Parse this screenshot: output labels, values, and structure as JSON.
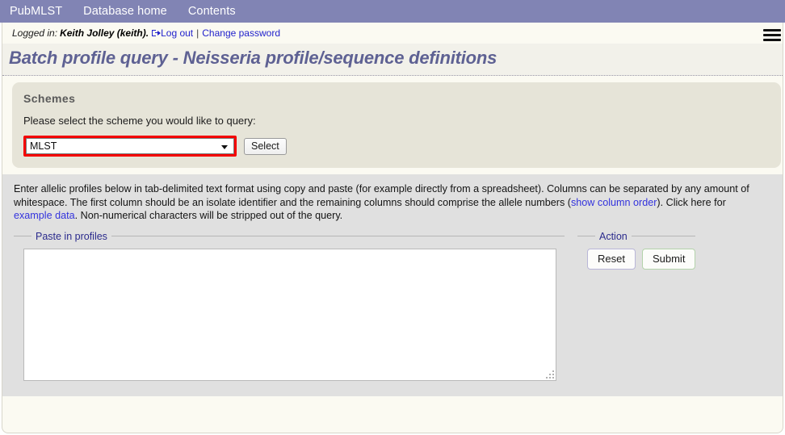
{
  "nav": {
    "items": [
      {
        "label": "PubMLST"
      },
      {
        "label": "Database home"
      },
      {
        "label": "Contents"
      }
    ]
  },
  "login_bar": {
    "logged_in_label": "Logged in:",
    "user": "Keith Jolley (keith).",
    "logout_label": "Log out",
    "separator": "|",
    "change_password_label": "Change password",
    "menu_icon": "hamburger-icon"
  },
  "page": {
    "title": "Batch profile query - Neisseria profile/sequence definitions"
  },
  "schemes": {
    "heading": "Schemes",
    "instruction": "Please select the scheme you would like to query:",
    "selected_scheme": "MLST",
    "select_button_label": "Select",
    "highlight_color": "#f40000",
    "dropdown_icon": "chevron-down-icon"
  },
  "query": {
    "blurb_part1": "Enter allelic profiles below in tab-delimited text format using copy and paste (for example directly from a spreadsheet). Columns can be separated by any amount of whitespace. The first column should be an isolate identifier and the remaining columns should comprise the allele numbers (",
    "link_show_column_order": "show column order",
    "blurb_part2": "). Click here for ",
    "link_example_data": "example data",
    "blurb_part3": ". Non-numerical characters will be stripped out of the query.",
    "paste_legend": "Paste in profiles",
    "textarea_value": "",
    "textarea_placeholder": "",
    "action_legend": "Action",
    "reset_label": "Reset",
    "submit_label": "Submit"
  },
  "colors": {
    "nav_bar": "#8184b4",
    "title_text": "#5e6193",
    "schemes_panel": "#e6e4d8",
    "query_panel": "#e0e0e0",
    "page_background": "#fbfaf2",
    "link": "#3333dd",
    "legend_text": "#2a2a8c",
    "reset_border": "#b9b6d8",
    "submit_border": "#b4d3ab"
  }
}
